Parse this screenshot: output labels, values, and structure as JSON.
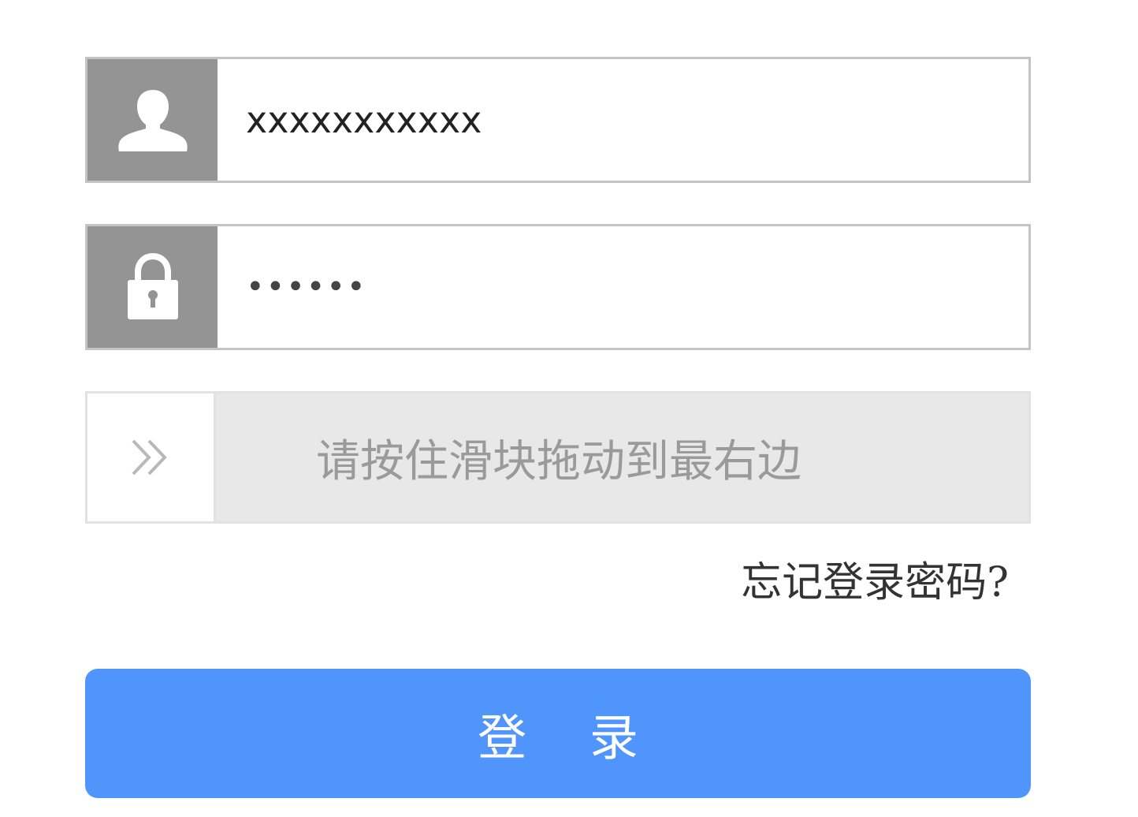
{
  "login_form": {
    "username": {
      "value": "xxxxxxxxxxx",
      "icon": "user-icon"
    },
    "password": {
      "value": "••••••",
      "icon": "lock-icon"
    },
    "slider": {
      "hint": "请按住滑块拖动到最右边",
      "handle_icon": "double-chevron-right-icon"
    },
    "forgot_password_link": "忘记登录密码?",
    "login_button": "登 录"
  },
  "colors": {
    "icon_background": "#949494",
    "field_border": "#c4c4c4",
    "slider_background": "#e8e8e8",
    "slider_text": "#9a9a9a",
    "primary_button": "#4f95fb"
  }
}
